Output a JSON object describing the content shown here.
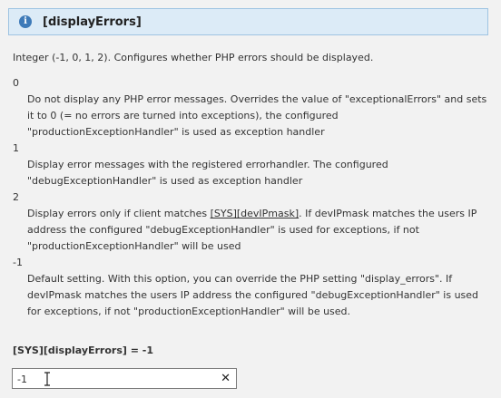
{
  "header": {
    "icon_glyph": "i",
    "title": "[displayErrors]"
  },
  "description": "Integer (-1, 0, 1, 2). Configures whether PHP errors should be displayed.",
  "values": [
    {
      "value": "0",
      "text": "Do not display any PHP error messages. Overrides the value of \"exceptionalErrors\" and sets it to 0 (= no errors are turned into exceptions), the configured \"productionExceptionHandler\" is used as exception handler"
    },
    {
      "value": "1",
      "text": "Display error messages with the registered errorhandler. The configured \"debugExceptionHandler\" is used as exception handler"
    },
    {
      "value": "2",
      "text_before": "Display errors only if client matches ",
      "link": "[SYS][devIPmask]",
      "text_after": ". If devIPmask matches the users IP address the configured \"debugExceptionHandler\" is used for exceptions, if not \"productionExceptionHandler\" will be used"
    },
    {
      "value": "-1",
      "text": "Default setting. With this option, you can override the PHP setting \"display_errors\". If devIPmask matches the users IP address the configured \"debugExceptionHandler\" is used for exceptions, if not \"productionExceptionHandler\" will be used."
    }
  ],
  "config": {
    "label": "[SYS][displayErrors] = -1",
    "input_value": "-1",
    "clear_glyph": "✕"
  },
  "icons": {
    "header_icon": "info-icon",
    "clear_icon": "close-icon",
    "cursor_icon": "text-cursor-icon"
  },
  "colors": {
    "header_bg": "#dcebf7",
    "header_border": "#9fc4e2",
    "icon_bg": "#3e7ab8",
    "page_bg": "#f2f2f2"
  }
}
